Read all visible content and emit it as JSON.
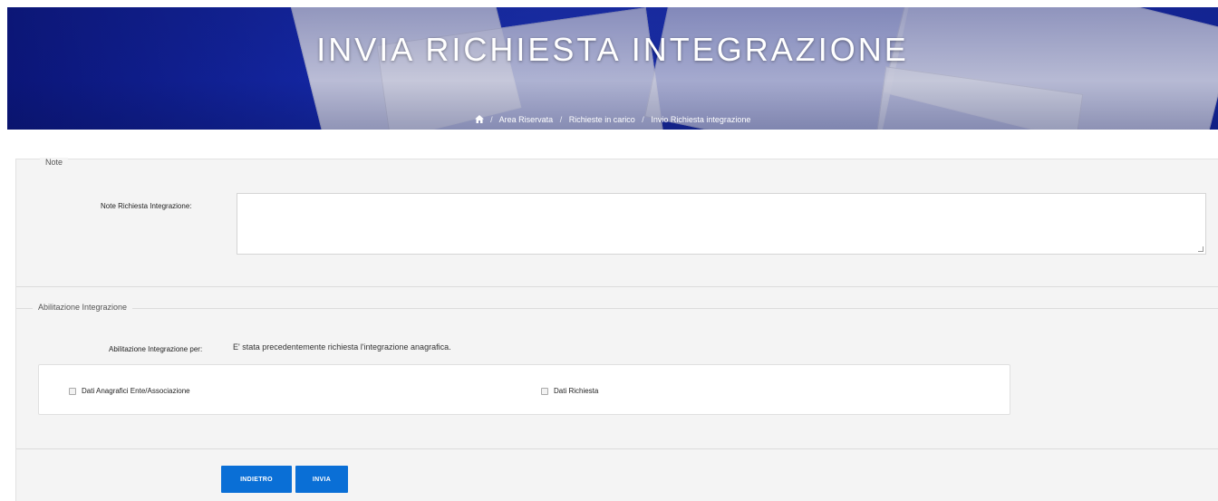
{
  "hero": {
    "title": "INVIA RICHIESTA INTEGRAZIONE",
    "breadcrumb": [
      "Area Riservata",
      "Richieste in carico",
      "Invio Richiesta integrazione"
    ]
  },
  "note_section": {
    "legend": "Note",
    "field_label": "Note Richiesta Integrazione:",
    "field_value": ""
  },
  "abilitazione_section": {
    "legend": "Abilitazione Integrazione",
    "label": "Abilitazione Integrazione per:",
    "value": "E' stata precedentemente richiesta l'integrazione anagrafica.",
    "checkboxes": [
      {
        "label": "Dati Anagrafici Ente/Associazione",
        "checked": false
      },
      {
        "label": "Dati Richiesta",
        "checked": false
      }
    ]
  },
  "actions": {
    "back_label": "INDIETRO",
    "send_label": "INVIA"
  },
  "colors": {
    "primary_button": "#0a6fd6",
    "hero_blue": "#1a2fb0"
  }
}
